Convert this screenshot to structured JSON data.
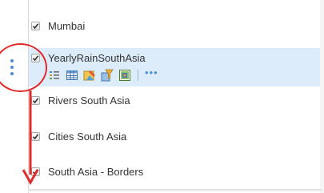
{
  "layers": [
    {
      "label": "Mumbai",
      "checked": true
    },
    {
      "label": "YearlyRainSouthAsia",
      "checked": true,
      "selected": true,
      "tools": [
        "legend-icon",
        "table-icon",
        "style-icon",
        "filter-icon",
        "analysis-icon"
      ],
      "more_label": "•••"
    },
    {
      "label": "Rivers South Asia",
      "checked": true
    },
    {
      "label": "Cities South Asia",
      "checked": true
    },
    {
      "label": "South Asia - Borders",
      "checked": true
    }
  ],
  "colors": {
    "selected_row": "#dcecfb",
    "accent_blue": "#4a8fd4",
    "annotation_red": "#e12a2a"
  }
}
